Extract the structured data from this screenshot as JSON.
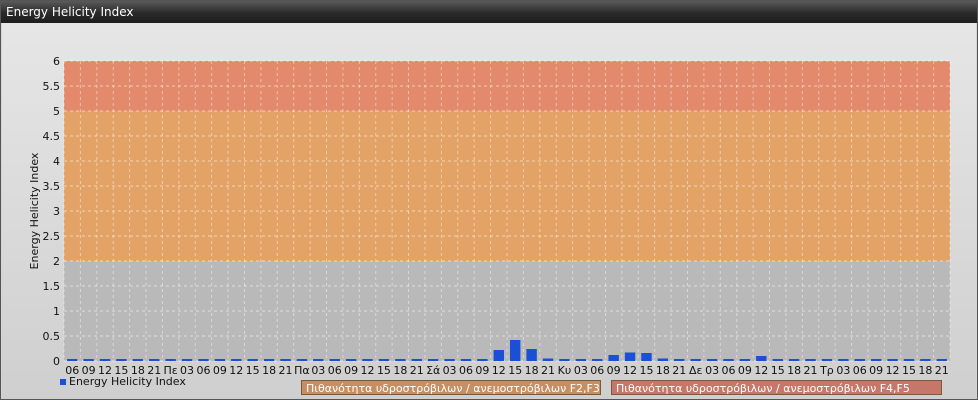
{
  "window": {
    "title": "Energy Helicity Index"
  },
  "chart_data": {
    "type": "bar",
    "title": "",
    "ylabel": "Energy Helicity Index",
    "ylim": [
      0,
      6
    ],
    "yticks": [
      "0",
      "0.5",
      "1",
      "1.5",
      "2",
      "2.5",
      "3",
      "3.5",
      "4",
      "4.5",
      "5",
      "5.5",
      "6"
    ],
    "categories": [
      "06",
      "09",
      "12",
      "15",
      "18",
      "21",
      "Πε",
      "03",
      "06",
      "09",
      "12",
      "15",
      "18",
      "21",
      "Πα",
      "03",
      "06",
      "09",
      "12",
      "15",
      "18",
      "21",
      "Σά",
      "03",
      "06",
      "09",
      "12",
      "15",
      "18",
      "21",
      "Κυ",
      "03",
      "06",
      "09",
      "12",
      "15",
      "18",
      "21",
      "Δε",
      "03",
      "06",
      "09",
      "12",
      "15",
      "18",
      "21",
      "Τρ",
      "03",
      "06",
      "09",
      "12",
      "15",
      "18",
      "21"
    ],
    "series": [
      {
        "name": "Energy Helicity Index",
        "color": "#1a4fd6",
        "values": [
          0.02,
          0.01,
          0.01,
          0.01,
          0.01,
          0.01,
          0.01,
          0.02,
          0.01,
          0.01,
          0.01,
          0.01,
          0.01,
          0.01,
          0.01,
          0.01,
          0.01,
          0.01,
          0.01,
          0.01,
          0.01,
          0.01,
          0.01,
          0.01,
          0.01,
          0.01,
          0.22,
          0.42,
          0.24,
          0.05,
          0.01,
          0.01,
          0.01,
          0.12,
          0.17,
          0.16,
          0.05,
          0.01,
          0.01,
          0.01,
          0.01,
          0.01,
          0.1,
          0.01,
          0.01,
          0.02,
          0.01,
          0.01,
          0.01,
          0.01,
          0.01,
          0.01,
          0.01,
          0.01
        ]
      }
    ],
    "bands": [
      {
        "from": 0,
        "to": 2,
        "color": "#b9b9b9"
      },
      {
        "from": 2,
        "to": 5,
        "color": "#e3a366",
        "label": "Πιθανότητα υδροστρόβιλων / ανεμοστρόβιλων F2,F3"
      },
      {
        "from": 5,
        "to": 6,
        "color": "#e3896c",
        "label": "Πιθανότητα υδροστρόβιλων / ανεμοστρόβιλων F4,F5"
      }
    ],
    "grid": true,
    "legend_position": "bottom-left"
  },
  "legend": {
    "series_label": "Energy Helicity Index",
    "band_f23": "Πιθανότητα υδροστρόβιλων / ανεμοστρόβιλων F2,F3",
    "band_f45": "Πιθανότητα υδροστρόβιλων / ανεμοστρόβιλων F4,F5"
  }
}
